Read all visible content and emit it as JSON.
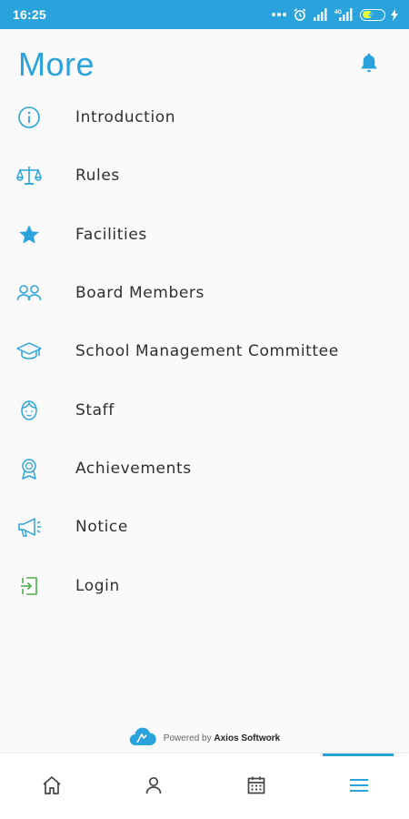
{
  "status_bar": {
    "time": "16:25",
    "battery": "49",
    "network_label": "4G"
  },
  "header": {
    "title": "More"
  },
  "menu": [
    {
      "label": "Introduction",
      "icon": "info-icon"
    },
    {
      "label": "Rules",
      "icon": "scales-icon"
    },
    {
      "label": "Facilities",
      "icon": "star-icon"
    },
    {
      "label": "Board Members",
      "icon": "people-icon"
    },
    {
      "label": "School Management Committee",
      "icon": "graduation-cap-icon"
    },
    {
      "label": "Staff",
      "icon": "person-face-icon"
    },
    {
      "label": "Achievements",
      "icon": "award-icon"
    },
    {
      "label": "Notice",
      "icon": "megaphone-icon"
    },
    {
      "label": "Login",
      "icon": "login-icon"
    }
  ],
  "footer": {
    "powered_by": "Powered by",
    "company": "Axios Softwork"
  },
  "bottom_nav": [
    {
      "name": "home",
      "icon": "home-icon"
    },
    {
      "name": "profile",
      "icon": "person-icon"
    },
    {
      "name": "calendar",
      "icon": "calendar-icon"
    },
    {
      "name": "more",
      "icon": "menu-icon",
      "active": true
    }
  ],
  "colors": {
    "accent": "#2aa3dd",
    "login_icon": "#4caf50",
    "text": "#2f2f2f",
    "background": "#fafafa"
  }
}
